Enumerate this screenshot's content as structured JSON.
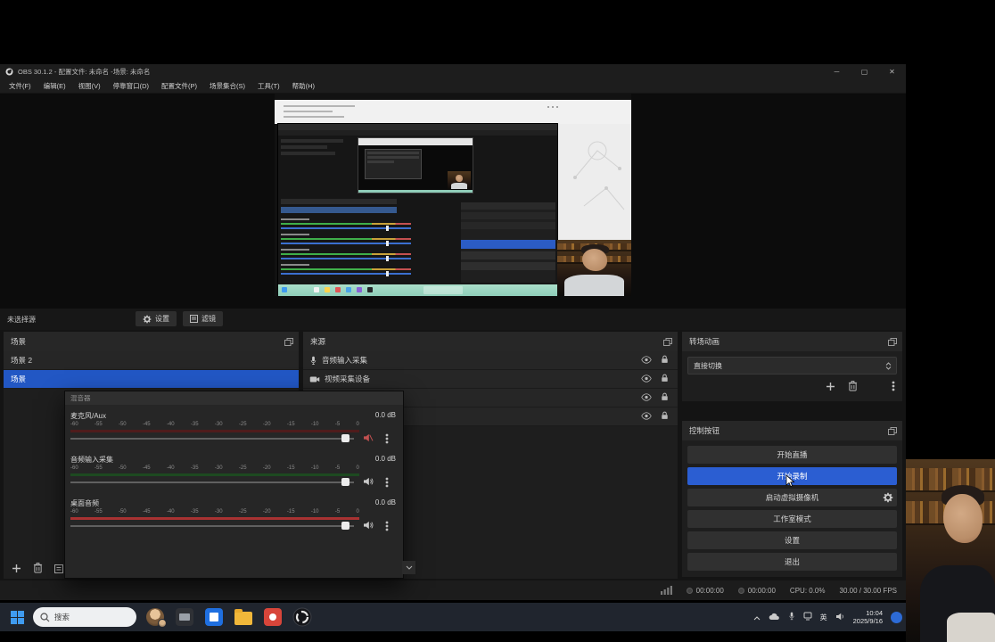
{
  "colors": {
    "accent_blue": "#2b5ed2",
    "selected_row": "#2257c4",
    "meter_ch1": "#4f1c1c",
    "meter_ch2": "#1d4a20",
    "meter_ch3": "#a83232",
    "nested_taskbar": "#8fcdb9"
  },
  "titlebar": {
    "title": "OBS 30.1.2 - 配置文件: 未命名 -场景: 未命名"
  },
  "menubar": {
    "items": [
      "文件(F)",
      "编辑(E)",
      "视图(V)",
      "停靠窗口(D)",
      "配置文件(P)",
      "场景集合(S)",
      "工具(T)",
      "帮助(H)"
    ]
  },
  "selection_bar": {
    "no_source": "未选择源",
    "settings": "设置",
    "filters": "滤镜"
  },
  "scenes": {
    "title": "场景",
    "items": [
      {
        "label": "场景 2"
      },
      {
        "label": "场景"
      }
    ]
  },
  "sources": {
    "title": "来源",
    "rows": [
      {
        "label": "音频输入采集"
      },
      {
        "label": "视频采集设备"
      },
      {
        "label": ""
      },
      {
        "label": ""
      }
    ]
  },
  "transitions": {
    "title": "转场动画",
    "current": "直接切换"
  },
  "controls": {
    "title": "控制按钮",
    "buttons": [
      "开始直播",
      "开始录制",
      "启动虚拟摄像机",
      "工作室模式",
      "设置",
      "退出"
    ]
  },
  "mixer": {
    "title": "混音器",
    "scale": [
      "-60",
      "-55",
      "-50",
      "-45",
      "-40",
      "-35",
      "-30",
      "-25",
      "-20",
      "-15",
      "-10",
      "-5",
      "0"
    ],
    "channels": [
      {
        "name": "麦克风/Aux",
        "db": "0.0 dB"
      },
      {
        "name": "音频输入采集",
        "db": "0.0 dB"
      },
      {
        "name": "桌面音频",
        "db": "0.0 dB"
      }
    ]
  },
  "statusbar": {
    "rec_time": "00:00:00",
    "stream_time": "00:00:00",
    "cpu": "CPU: 0.0%",
    "fps": "30.00 / 30.00 FPS"
  },
  "taskbar": {
    "search": "搜索",
    "ime": "英",
    "time": "10:04",
    "date": "2025/9/16"
  }
}
